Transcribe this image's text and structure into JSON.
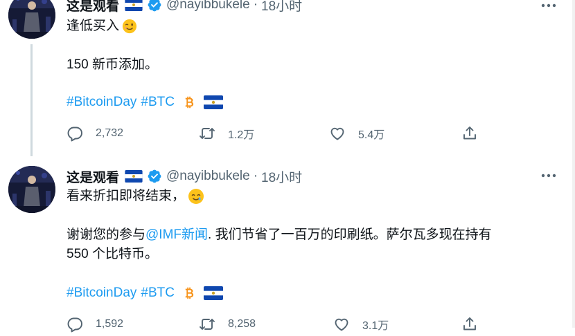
{
  "tweets": [
    {
      "author_name": "这是观看",
      "handle": "@nayibbukele",
      "separator": "·",
      "time": "18小时",
      "line1": "逢低买入",
      "line2": "150 新币添加。",
      "hashtag1": "#BitcoinDay",
      "hashtag2": "#BTC",
      "replies": "2,732",
      "retweets": "1.2万",
      "likes": "5.4万"
    },
    {
      "author_name": "这是观看",
      "handle": "@nayibbukele",
      "separator": "·",
      "time": "18小时",
      "line1": "看来折扣即将结束，",
      "line2_pre": "谢谢您的参与",
      "line2_mention": "@IMF新闻",
      "line2_post": ". 我们节省了一百万的印刷纸。萨尔瓦多现在持有",
      "line3": "550 个比特币。",
      "hashtag1": "#BitcoinDay",
      "hashtag2": "#BTC",
      "replies": "1,592",
      "retweets": "8,258",
      "likes": "3.1万"
    }
  ],
  "icons": {
    "flag": "el-salvador-flag-icon",
    "verified": "verified-badge-icon",
    "bitcoin": "bitcoin-icon",
    "more": "more-icon",
    "reply": "reply-icon",
    "retweet": "retweet-icon",
    "like": "like-icon",
    "share": "share-icon",
    "wink_emoji": "winking-face-emoji",
    "tear_emoji": "smiling-face-with-tear-emoji"
  },
  "colors": {
    "link": "#1d9bf0",
    "text": "#0f1419",
    "muted": "#536471",
    "bitcoin": "#f7931a",
    "flag_blue": "#0f47af"
  }
}
